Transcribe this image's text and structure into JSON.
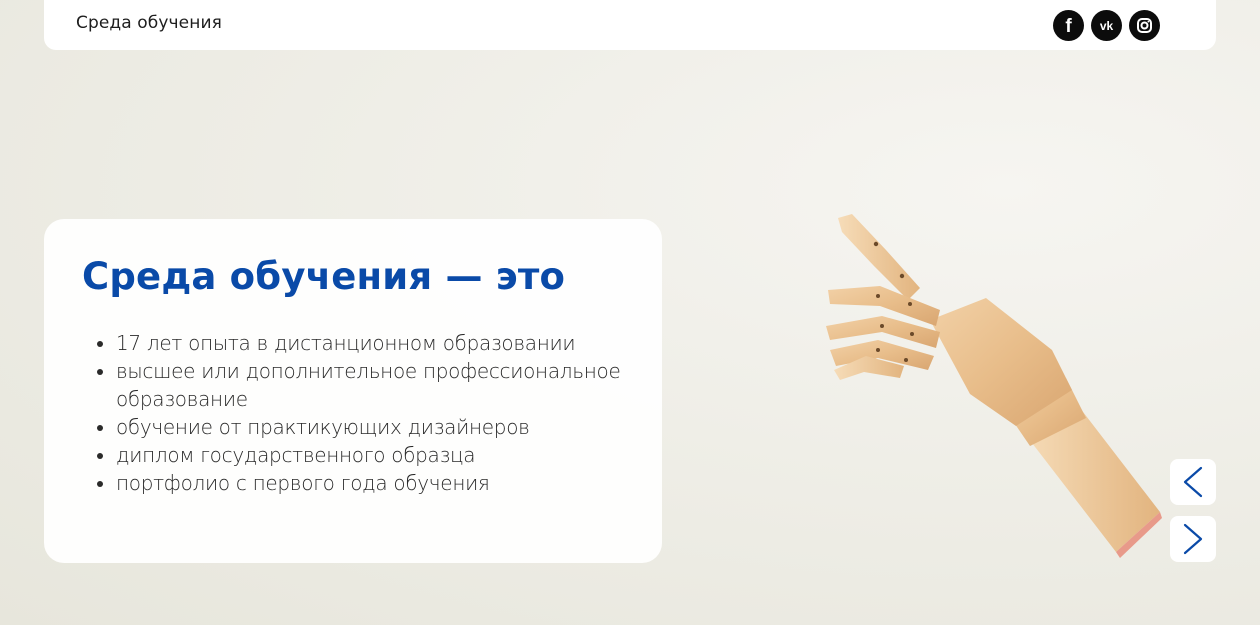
{
  "header": {
    "brand": "Среда обучения",
    "socials": [
      {
        "icon": "facebook-icon",
        "glyph": "f"
      },
      {
        "icon": "vk-icon",
        "glyph": "vk"
      },
      {
        "icon": "instagram-icon",
        "glyph": ""
      }
    ]
  },
  "card": {
    "title": "Среда обучения — это",
    "items": [
      "17 лет опыта в дистанционном образовании",
      "высшее или дополнительное профессиональное образование",
      "обучение от практикующих дизайнеров",
      "диплом государственного образца",
      "портфолио с первого года обучения"
    ]
  },
  "slider": {
    "prev_icon": "chevron-left-icon",
    "next_icon": "chevron-right-icon"
  },
  "colors": {
    "accent": "#0a4aa8",
    "background": "#efeee7",
    "social_bg": "#0c0c0c"
  }
}
